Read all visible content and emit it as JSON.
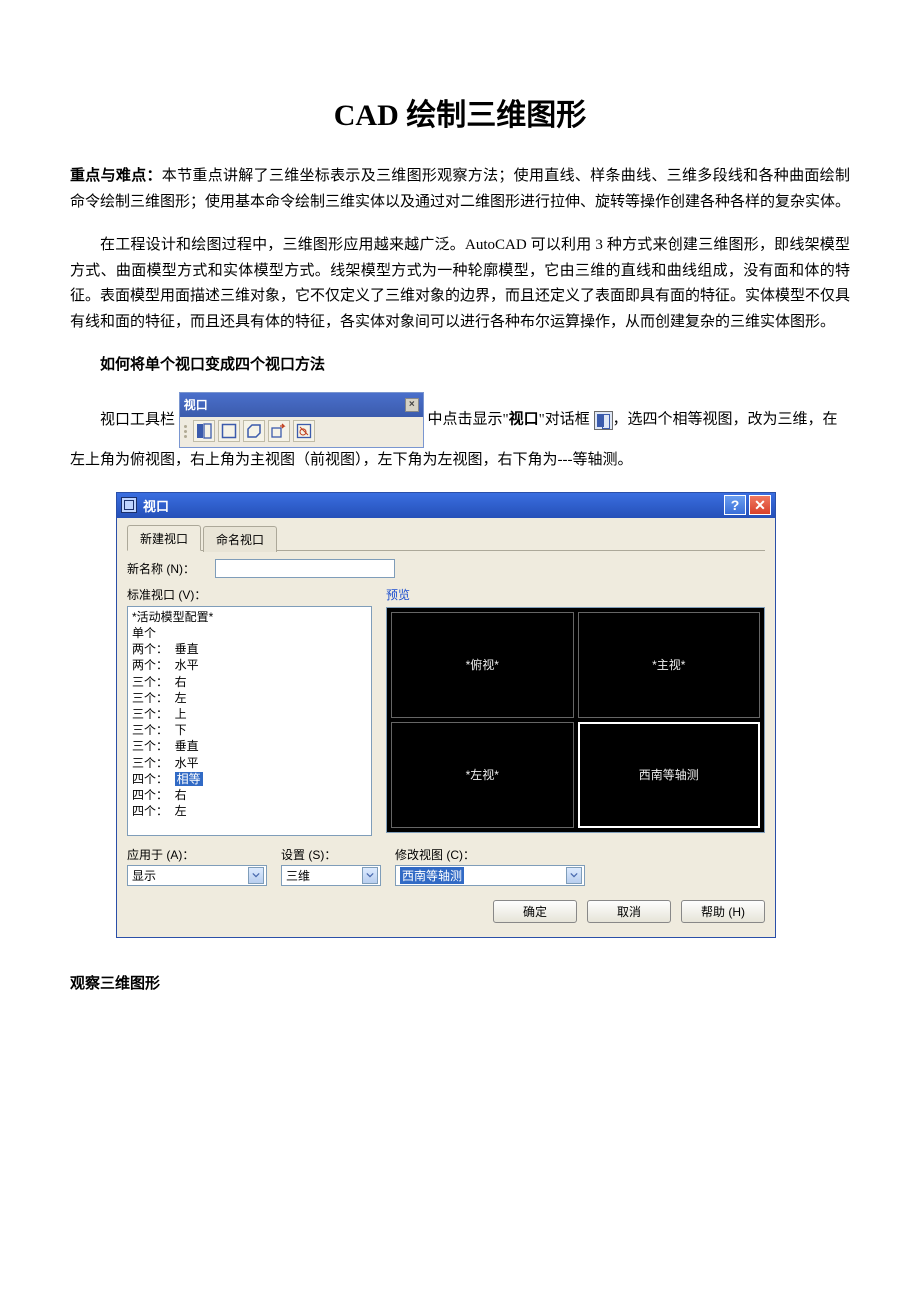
{
  "title": "CAD 绘制三维图形",
  "intro_label": "重点与难点：",
  "intro_body": "本节重点讲解了三维坐标表示及三维图形观察方法；使用直线、样条曲线、三维多段线和各种曲面绘制命令绘制三维图形；使用基本命令绘制三维实体以及通过对二维图形进行拉伸、旋转等操作创建各种各样的复杂实体。",
  "para2": "在工程设计和绘图过程中，三维图形应用越来越广泛。AutoCAD 可以利用 3 种方式来创建三维图形，即线架模型方式、曲面模型方式和实体模型方式。线架模型方式为一种轮廓模型，它由三维的直线和曲线组成，没有面和体的特征。表面模型用面描述三维对象，它不仅定义了三维对象的边界，而且还定义了表面即具有面的特征。实体模型不仅具有线和面的特征，而且还具有体的特征，各实体对象间可以进行各种布尔运算操作，从而创建复杂的三维实体图形。",
  "subheading1": "如何将单个视口变成四个视口方法",
  "toolbar": {
    "title": "视口"
  },
  "inline_para": {
    "lead": "视口工具栏",
    "mid1": "中点击显示\"",
    "mid_bold": "视口",
    "mid2": "\"对话框",
    "tail": "，选四个相等视图，改为三维，在左上角为俯视图，右上角为主视图（前视图），左下角为左视图，右下角为---等轴测。"
  },
  "dialog": {
    "title": "视口",
    "tabs": {
      "t1": "新建视口",
      "t2": "命名视口"
    },
    "newname_label": "新名称 (N)：",
    "stdvp_label": "标准视口 (V)：",
    "preview_label": "预览",
    "list": [
      "*活动模型配置*",
      "单个",
      "两个：  垂直",
      "两个：  水平",
      "三个：  右",
      "三个：  左",
      "三个：  上",
      "三个：  下",
      "三个：  垂直",
      "三个：  水平",
      "四个：  相等",
      "四个：  右",
      "四个：  左"
    ],
    "list_selected_index": 10,
    "viewports": {
      "tl": "*俯视*",
      "tr": "*主视*",
      "bl": "*左视*",
      "br": "西南等轴测"
    },
    "apply_label": "应用于 (A)：",
    "apply_value": "显示",
    "setting_label": "设置 (S)：",
    "setting_value": "三维",
    "modify_label": "修改视图 (C)：",
    "modify_value": "西南等轴测",
    "buttons": {
      "ok": "确定",
      "cancel": "取消",
      "help": "帮助 (H)"
    }
  },
  "subheading2": "观察三维图形"
}
